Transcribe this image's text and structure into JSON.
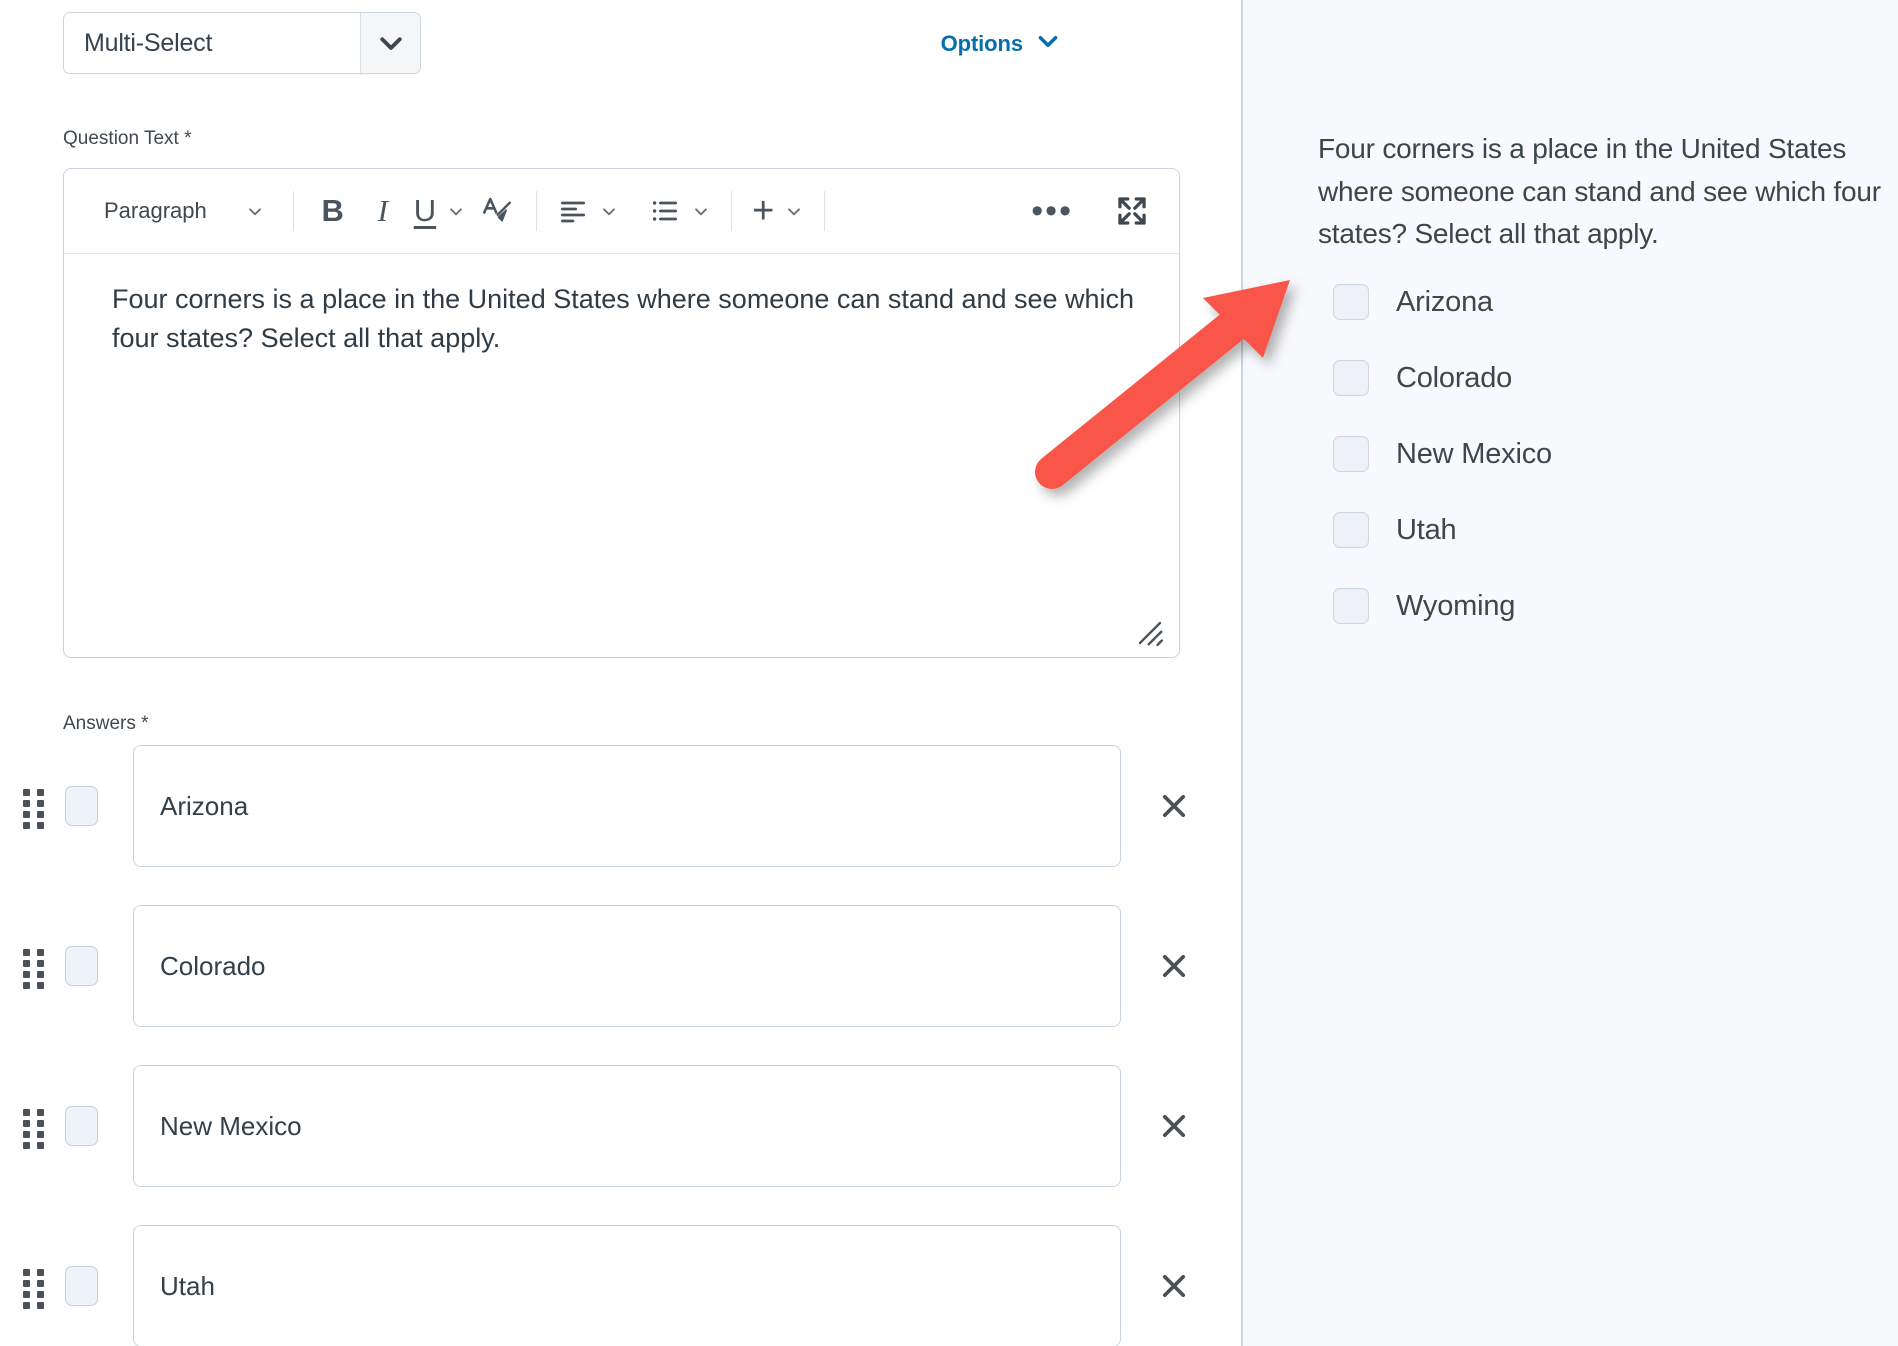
{
  "question_type": {
    "label": "Multi-Select",
    "caret_icon": "chevron-down-icon"
  },
  "options_link": {
    "label": "Options",
    "icon": "chevron-down-icon",
    "color": "#066fab"
  },
  "labels": {
    "question_text": "Question Text *",
    "answers": "Answers *"
  },
  "editor": {
    "toolbar": {
      "paragraph_label": "Paragraph",
      "bold_label": "B",
      "italic_label": "I",
      "underline_label": "U",
      "text_color_label": "A",
      "align_label": "align-left-icon",
      "list_label": "bulleted-list-icon",
      "insert_label": "+",
      "more_label": "•••",
      "fullscreen_label": "fullscreen-icon"
    },
    "content": "Four corners is a place in the United States where someone can stand and see which four states? Select all that apply."
  },
  "answers": [
    {
      "value": "Arizona",
      "checked": false,
      "remove_label": "✕"
    },
    {
      "value": "Colorado",
      "checked": false,
      "remove_label": "✕"
    },
    {
      "value": "New Mexico",
      "checked": false,
      "remove_label": "✕"
    },
    {
      "value": "Utah",
      "checked": false,
      "remove_label": "✕"
    }
  ],
  "preview": {
    "question": "Four corners is a place in the United States where someone can stand and see which four states? Select all that apply.",
    "options": [
      {
        "label": "Arizona",
        "checked": false
      },
      {
        "label": "Colorado",
        "checked": false
      },
      {
        "label": "New Mexico",
        "checked": false
      },
      {
        "label": "Utah",
        "checked": false
      },
      {
        "label": "Wyoming",
        "checked": false
      }
    ]
  },
  "annotation": {
    "arrow_color": "#f9544a"
  }
}
